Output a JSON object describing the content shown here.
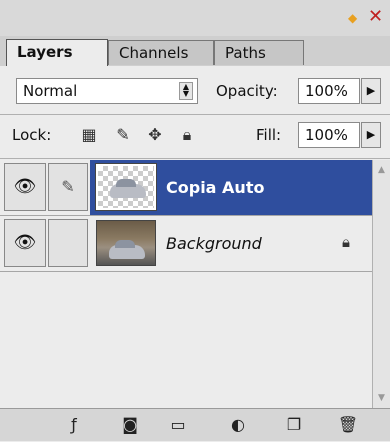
{
  "title_icons": {
    "diamond_icon": "diamond-icon",
    "close_icon": "close-icon"
  },
  "tabs": [
    {
      "label": "Layers"
    },
    {
      "label": "Channels"
    },
    {
      "label": "Paths"
    }
  ],
  "blend_mode": {
    "value": "Normal"
  },
  "opacity": {
    "label": "Opacity:",
    "value": "100%"
  },
  "lock": {
    "label": "Lock:"
  },
  "fill": {
    "label": "Fill:",
    "value": "100%"
  },
  "layers": [
    {
      "name": "Copia Auto",
      "selected": true,
      "visible": true
    },
    {
      "name": "Background",
      "selected": false,
      "visible": true,
      "locked": true
    }
  ],
  "colors": {
    "selection": "#2f4e9e",
    "panel": "#ececec",
    "toolbar": "#d6d6d6"
  }
}
